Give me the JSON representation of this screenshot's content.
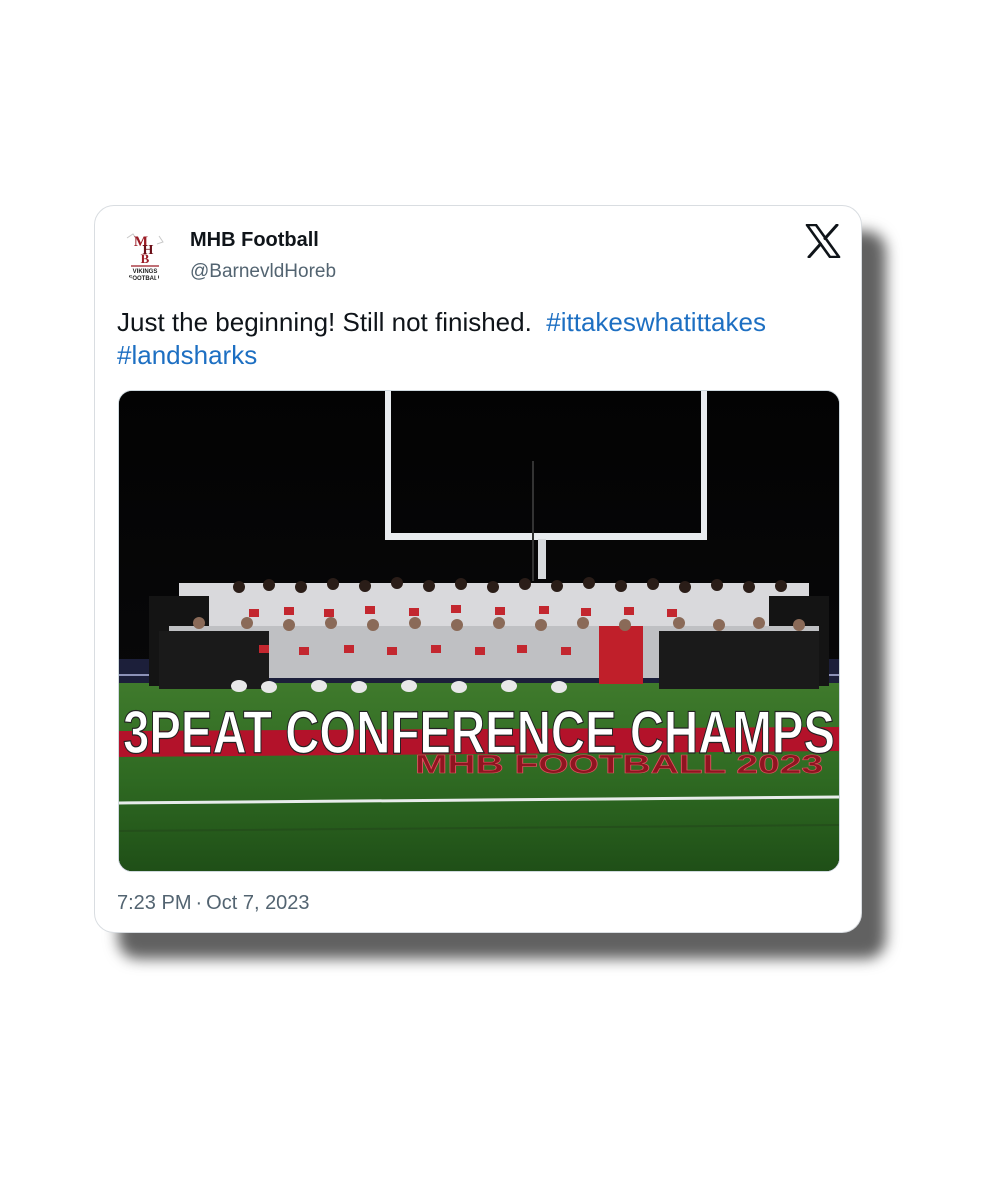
{
  "author": {
    "name": "MHB Football",
    "handle": "@BarnevldHoreb",
    "avatar_text": {
      "monogram_top": "M",
      "monogram_mid": "H",
      "monogram_bottom": "B",
      "line1": "VIKINGS",
      "line2": "FOOTBALL"
    }
  },
  "tweet": {
    "text": "Just the beginning!  Still not finished.",
    "hashtags": [
      "#ittakeswhatittakes",
      "#landsharks"
    ]
  },
  "media": {
    "headline": "3PEAT CONFERENCE CHAMPS",
    "subline": "MHB FOOTBALL 2023"
  },
  "meta": {
    "time": "7:23 PM",
    "separator": "·",
    "date": "Oct 7, 2023"
  },
  "icons": {
    "platform": "x-logo-icon"
  },
  "colors": {
    "hashtag": "#1d6fc2",
    "team_red": "#b3122a",
    "field_green": "#2f6b22"
  }
}
